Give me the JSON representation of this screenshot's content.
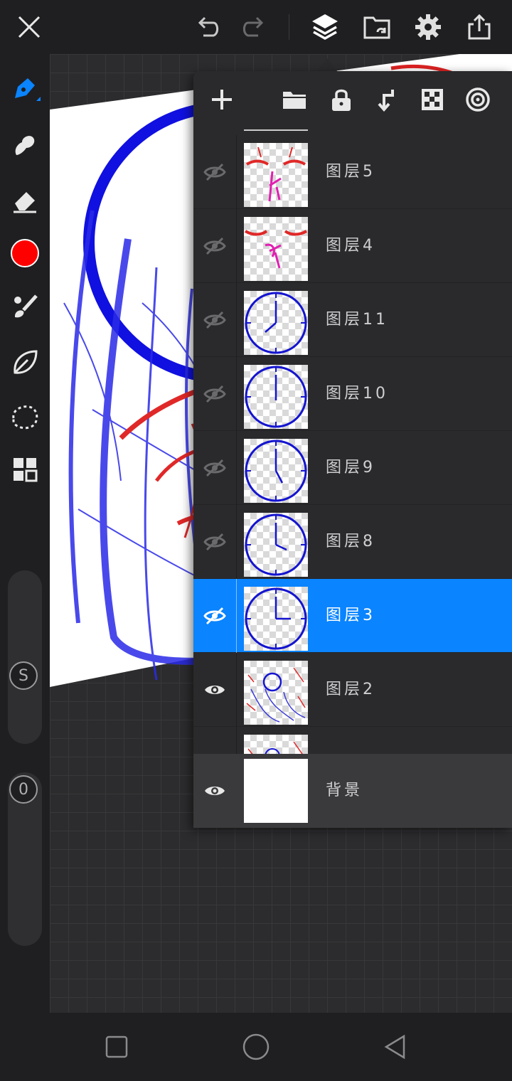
{
  "layers": [
    {
      "name": "图层5",
      "visible": false,
      "selected": false,
      "thumb": "face-red-pink"
    },
    {
      "name": "图层4",
      "visible": false,
      "selected": false,
      "thumb": "face-red-pink-2"
    },
    {
      "name": "图层11",
      "visible": false,
      "selected": false,
      "thumb": "clock"
    },
    {
      "name": "图层10",
      "visible": false,
      "selected": false,
      "thumb": "clock"
    },
    {
      "name": "图层9",
      "visible": false,
      "selected": false,
      "thumb": "clock"
    },
    {
      "name": "图层8",
      "visible": false,
      "selected": false,
      "thumb": "clock"
    },
    {
      "name": "图层3",
      "visible": true,
      "selected": true,
      "thumb": "clock"
    },
    {
      "name": "图层2",
      "visible": true,
      "selected": false,
      "thumb": "sketch"
    }
  ],
  "background_layer": {
    "name": "背景",
    "visible": true
  },
  "tools": {
    "brush_slider_label": "S",
    "opacity_slider_label": "0",
    "current_color": "#ff0000"
  },
  "colors": {
    "accent": "#0a84ff",
    "panel": "#2a2a2c",
    "toolbar": "#1f1f21"
  }
}
